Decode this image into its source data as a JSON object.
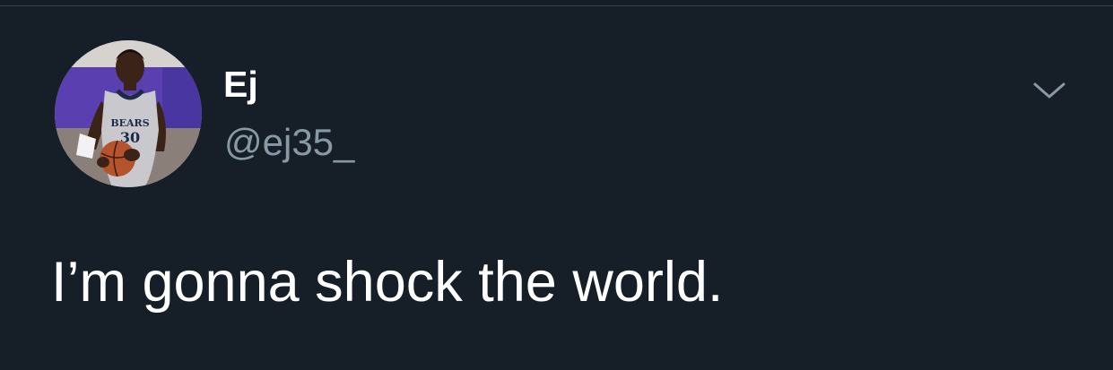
{
  "tweet": {
    "display_name": "Ej",
    "handle": "@ej35_",
    "text": "I’m gonna shock the world.",
    "avatar_jersey_text": "BEARS",
    "avatar_jersey_number": "30"
  },
  "icons": {
    "menu": "chevron-down-icon",
    "avatar": "avatar"
  },
  "colors": {
    "background": "#161e28",
    "divider": "#38444d",
    "name": "#ffffff",
    "handle": "#8899a6",
    "text": "#ffffff",
    "caret": "#8899a6"
  }
}
